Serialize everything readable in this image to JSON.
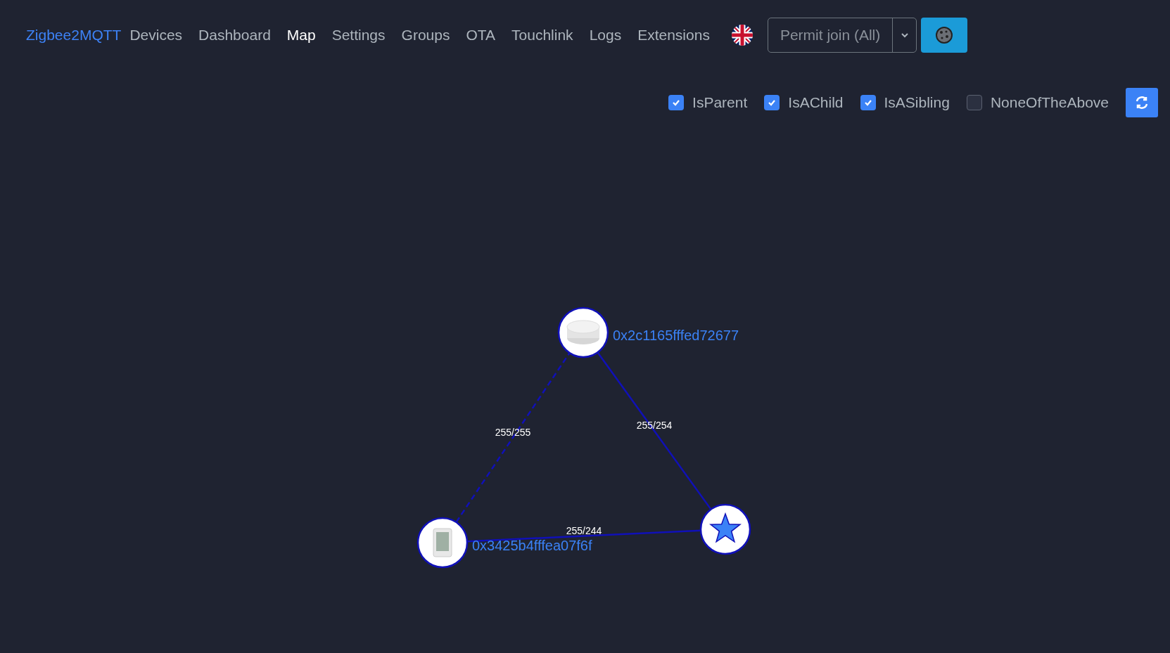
{
  "nav": {
    "brand": "Zigbee2MQTT",
    "items": [
      {
        "label": "Devices",
        "selected": false
      },
      {
        "label": "Dashboard",
        "selected": false
      },
      {
        "label": "Map",
        "selected": true
      },
      {
        "label": "Settings",
        "selected": false
      },
      {
        "label": "Groups",
        "selected": false
      },
      {
        "label": "OTA",
        "selected": false
      },
      {
        "label": "Touchlink",
        "selected": false
      },
      {
        "label": "Logs",
        "selected": false
      },
      {
        "label": "Extensions",
        "selected": false
      }
    ],
    "permit_join": {
      "label": "Permit join (All)"
    }
  },
  "filters": [
    {
      "label": "IsParent",
      "checked": true
    },
    {
      "label": "IsAChild",
      "checked": true
    },
    {
      "label": "IsASibling",
      "checked": true
    },
    {
      "label": "NoneOfTheAbove",
      "checked": false
    }
  ],
  "map": {
    "nodes": [
      {
        "kind": "router",
        "label": "0x2c1165fffed72677"
      },
      {
        "kind": "end_device",
        "label": "0x3425b4fffea07f6f"
      },
      {
        "kind": "coordinator"
      }
    ],
    "links": [
      {
        "kind": "dashed",
        "label": "255/255"
      },
      {
        "kind": "solid",
        "label": "255/254"
      },
      {
        "kind": "solid",
        "label": "255/244"
      }
    ]
  }
}
